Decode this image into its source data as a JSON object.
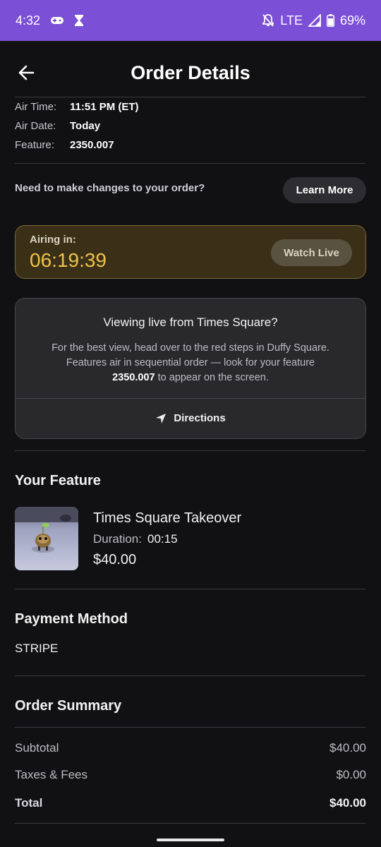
{
  "status_bar": {
    "time": "4:32",
    "network": "LTE",
    "battery": "69%"
  },
  "header": {
    "title": "Order Details"
  },
  "details": [
    {
      "label": "Air Time:",
      "value": "11:51 PM (ET)"
    },
    {
      "label": "Air Date:",
      "value": "Today"
    },
    {
      "label": "Feature:",
      "value": "2350.007"
    }
  ],
  "changes": {
    "text": "Need to make changes to your order?",
    "button": "Learn More"
  },
  "airing": {
    "label": "Airing in:",
    "countdown": "06:19:39",
    "button": "Watch Live",
    "accent": "#f0c24a"
  },
  "info_card": {
    "title": "Viewing live from Times Square?",
    "body_line1": "For the best view, head over to the red steps in Duffy Square.",
    "body_line2": "Features air in sequential order — look for your feature",
    "feature_number": "2350.007",
    "body_tail": " to appear on the screen.",
    "directions": "Directions"
  },
  "feature": {
    "section_title": "Your Feature",
    "name": "Times Square Takeover",
    "duration_label": "Duration:",
    "duration_value": "00:15",
    "price": "$40.00"
  },
  "payment": {
    "section_title": "Payment Method",
    "method": "STRIPE"
  },
  "summary": {
    "section_title": "Order Summary",
    "rows": [
      {
        "label": "Subtotal",
        "value": "$40.00"
      },
      {
        "label": "Taxes & Fees",
        "value": "$0.00"
      },
      {
        "label": "Total",
        "value": "$40.00"
      }
    ]
  },
  "colors": {
    "status_bar": "#7b4fd6",
    "background": "#111113"
  }
}
